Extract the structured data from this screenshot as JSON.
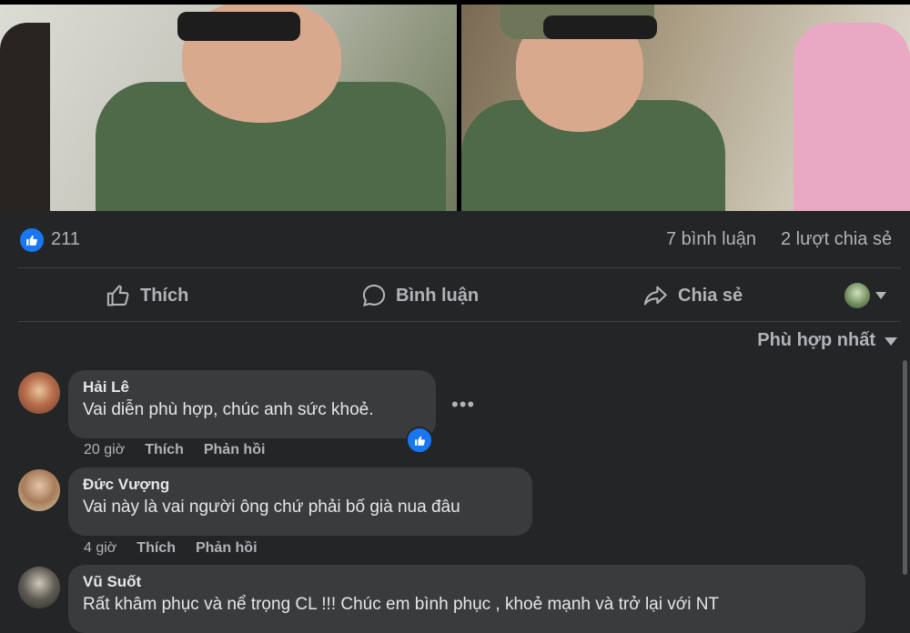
{
  "reactions": {
    "count": "211",
    "comments": "7 bình luận",
    "shares": "2 lượt chia sẻ"
  },
  "actions": {
    "like": "Thích",
    "comment": "Bình luận",
    "share": "Chia sẻ"
  },
  "sort": {
    "label": "Phù hợp nhất"
  },
  "comments": [
    {
      "name": "Hải Lê",
      "text": "Vai diễn phù hợp, chúc anh sức khoẻ.",
      "time": "20 giờ",
      "like": "Thích",
      "reply": "Phản hồi"
    },
    {
      "name": "Đức Vượng",
      "text": "Vai này là vai người ông chứ phải bố già nua đâu",
      "time": "4 giờ",
      "like": "Thích",
      "reply": "Phản hồi"
    },
    {
      "name": "Vũ Suốt",
      "text": "Rất khâm phục và nể trọng CL !!! Chúc em bình phục , khoẻ mạnh và trở lại với NT"
    }
  ],
  "colors": {
    "background": "#242526",
    "bubble": "#3a3b3c",
    "accent": "#1877f2",
    "muted": "#b0b3b8"
  },
  "icons": [
    "like-icon",
    "comment-icon",
    "share-icon",
    "more-icon",
    "chevron-down-icon"
  ]
}
